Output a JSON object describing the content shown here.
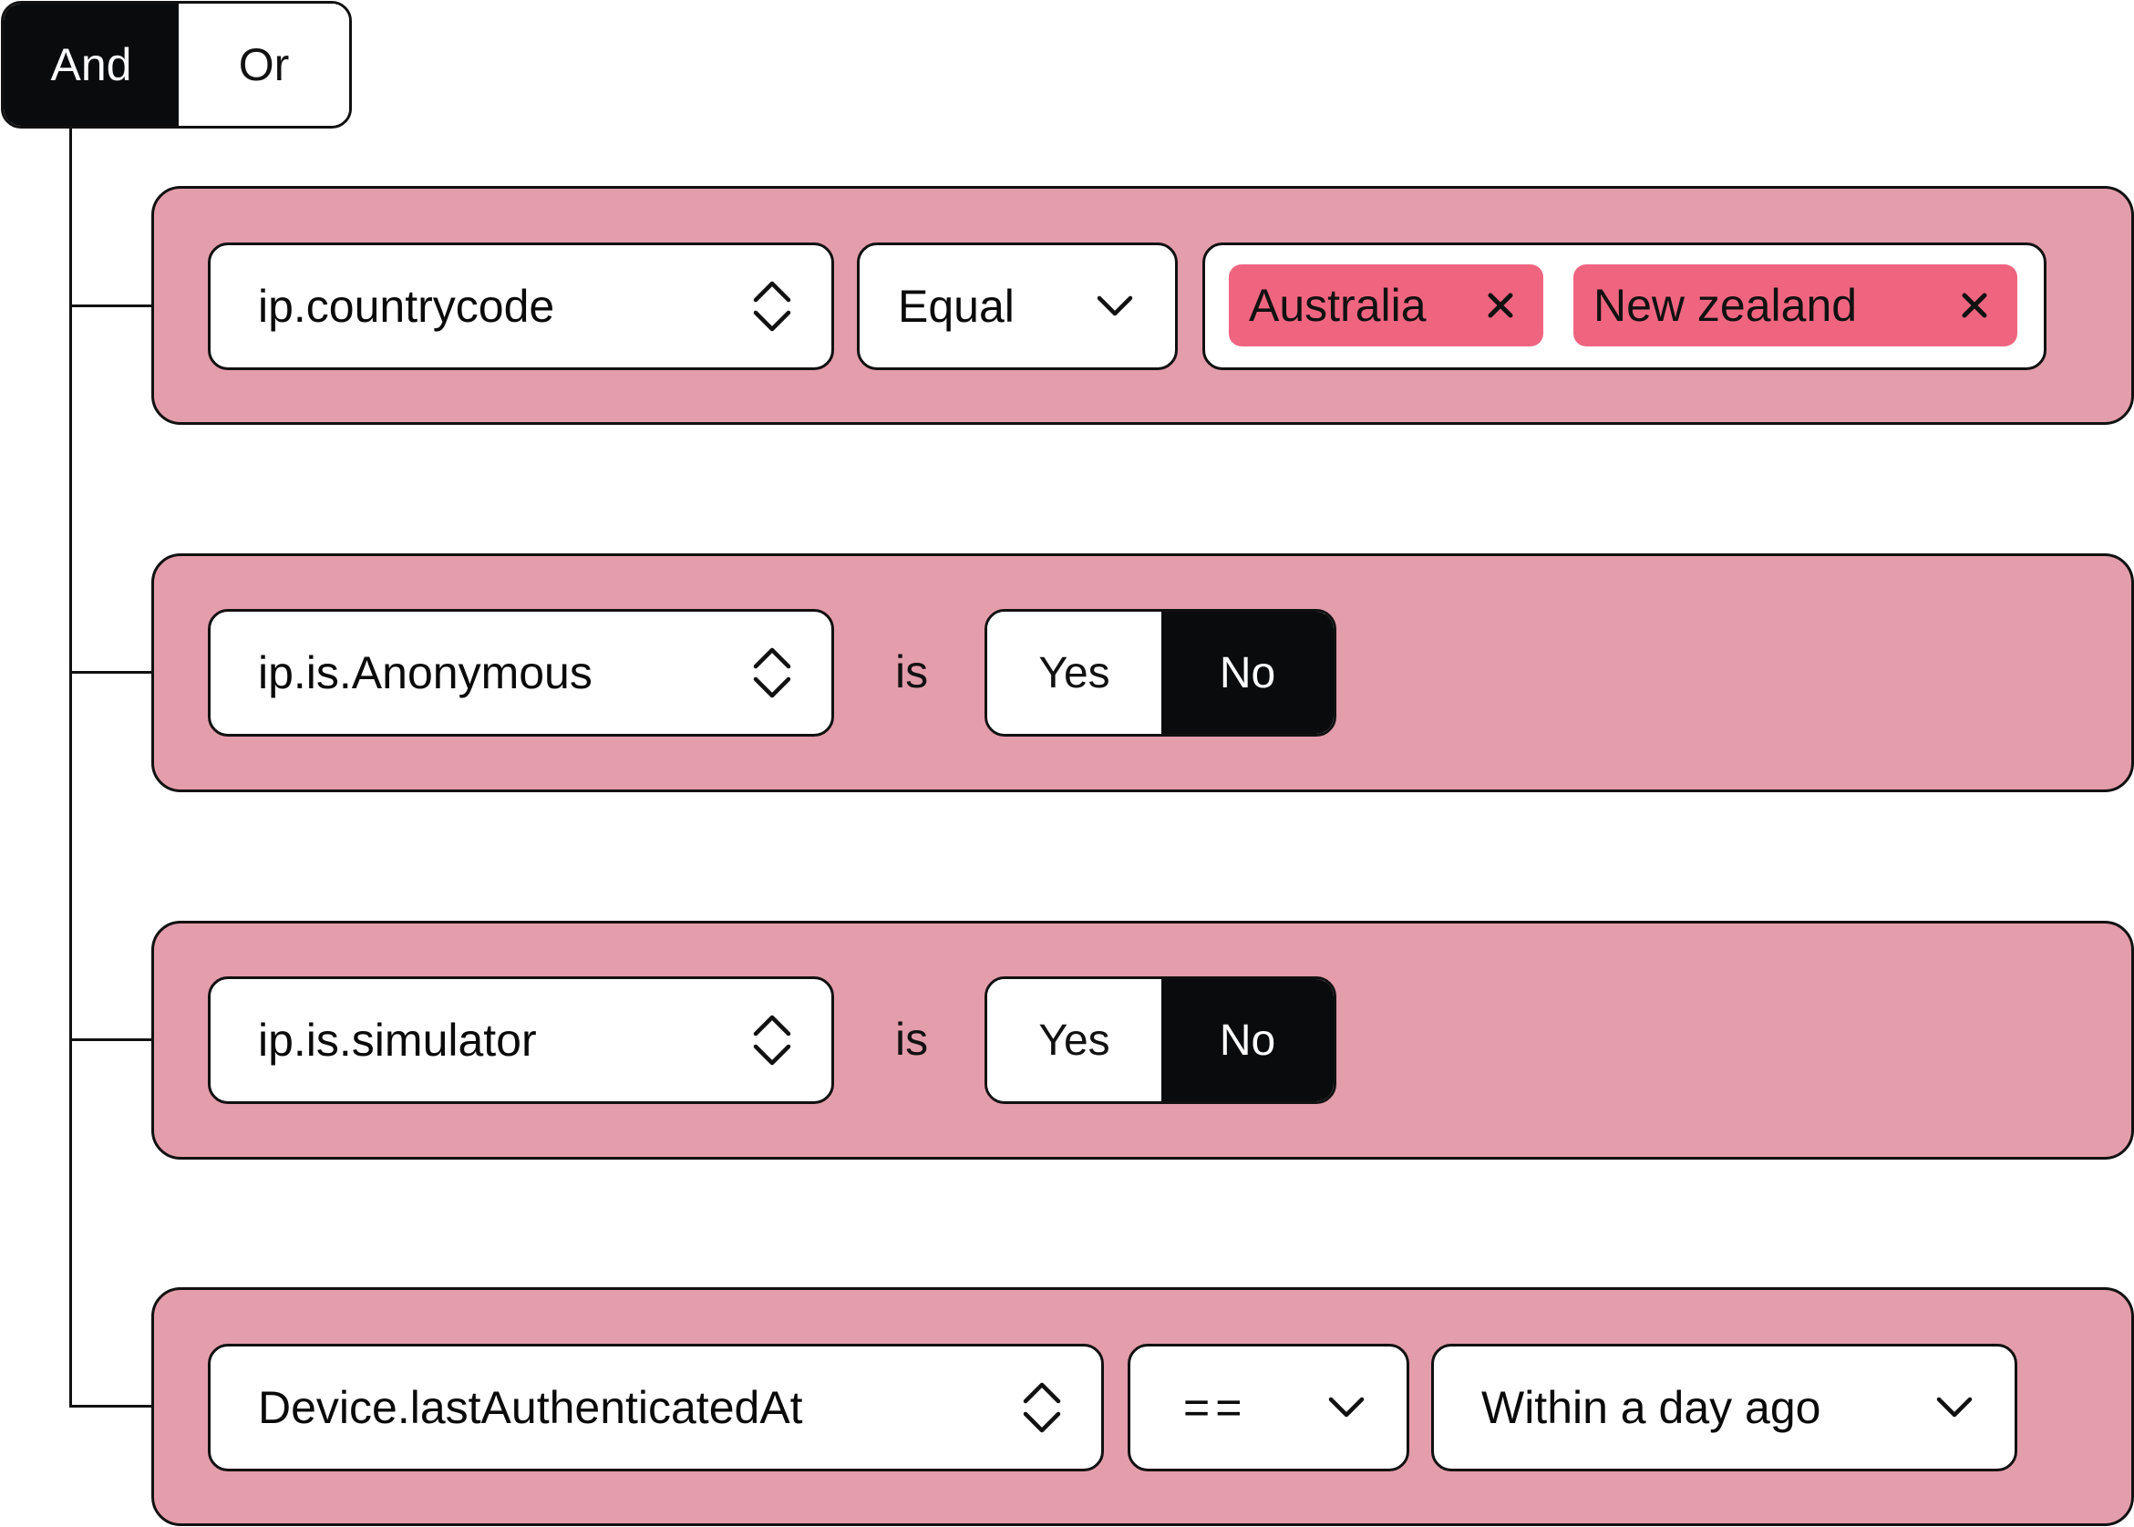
{
  "logic": {
    "and_label": "And",
    "or_label": "Or",
    "selected": "And"
  },
  "rules": [
    {
      "field": "ip.countrycode",
      "operator": "Equal",
      "tags": [
        "Australia",
        "New zealand"
      ]
    },
    {
      "field": "ip.is.Anonymous",
      "connector": "is",
      "yes_label": "Yes",
      "no_label": "No",
      "selected": "No"
    },
    {
      "field": "ip.is.simulator",
      "connector": "is",
      "yes_label": "Yes",
      "no_label": "No",
      "selected": "No"
    },
    {
      "field": "Device.lastAuthenticatedAt",
      "operator": "==",
      "value": "Within a day ago"
    }
  ],
  "colors": {
    "row_background": "#e39dab",
    "tag_background": "#ef6580",
    "selected_segment": "#0a0b0d",
    "border": "#111111"
  },
  "icons": {
    "field_selector": "stepper-icon",
    "dropdown": "chevron-down-icon",
    "tag_remove": "close-icon"
  }
}
